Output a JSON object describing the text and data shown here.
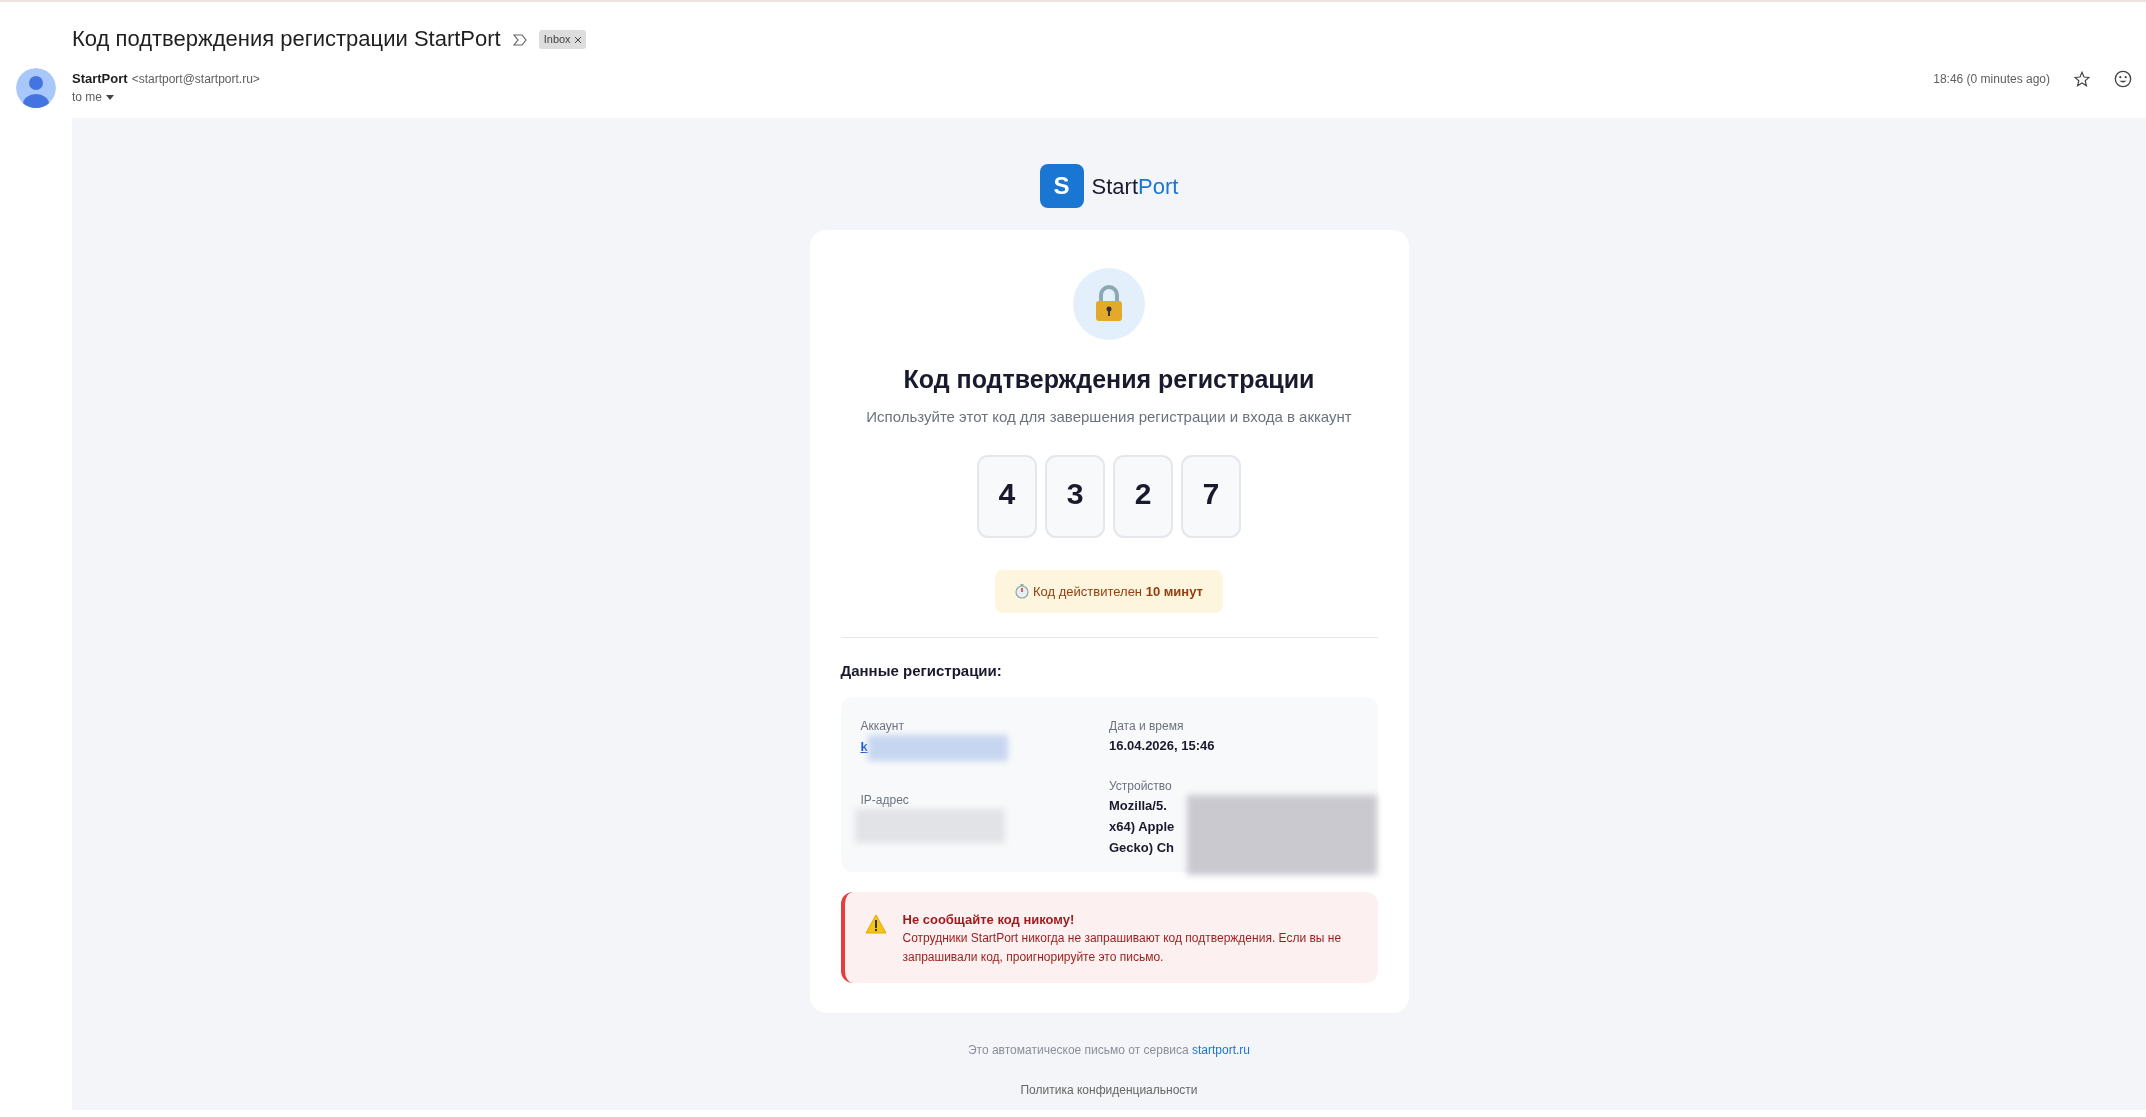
{
  "email": {
    "subject": "Код подтверждения регистрации StartPort",
    "label": "Inbox",
    "sender_name": "StartPort",
    "sender_email": "<startport@startport.ru>",
    "recipient": "to me",
    "time": "18:46 (0 minutes ago)",
    "starred": false
  },
  "message": {
    "brand": {
      "logo_letter": "S",
      "name": "Start",
      "name_accent": "Port"
    },
    "title": "Код подтверждения регистрации",
    "subtitle": "Используйте этот код для завершения регистрации и входа в аккаунт",
    "code": [
      "4",
      "3",
      "2",
      "7"
    ],
    "validity": "Код действителен **10 минут**",
    "details_heading": "Данные регистрации:",
    "details": [
      {
        "label": "Аккаунт",
        "kind": "link",
        "lines": [
          "k"
        ],
        "redacted": true
      },
      {
        "label": "IP-адрес",
        "kind": "hidden",
        "redacted": true
      },
      {
        "label": "Дата и время",
        "kind": "text",
        "lines": [
          "16.04.2026, 15:46"
        ],
        "redacted": false
      },
      {
        "label": "Устройство",
        "kind": "text",
        "lines": [
          "Mozilla/5.",
          "x64) Apple",
          "Gecko) Ch"
        ],
        "redacted": true
      }
    ],
    "warning": {
      "title": "Не сообщайте код никому!",
      "text": "Сотрудники StartPort никогда не запрашивают код подтверждения. Если вы не запрашивали код, проигнорируйте это письмо."
    },
    "footer": {
      "text": "Это автоматическое письмо от сервиса",
      "link": "startport.ru",
      "privacy": "Политика конфиденциальности"
    }
  }
}
